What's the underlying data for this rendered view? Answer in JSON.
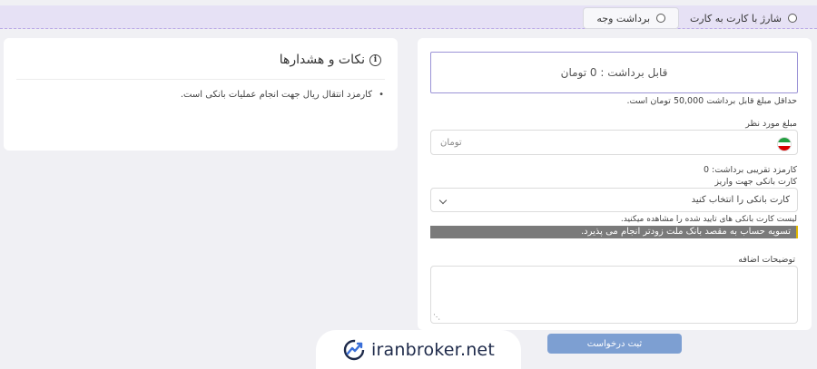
{
  "tabs": [
    {
      "label": "شارژ با کارت به کارت",
      "active": false
    },
    {
      "label": "برداشت وجه",
      "active": true
    }
  ],
  "notes": {
    "title": "نکات و هشدارها",
    "icon": "info-icon",
    "items": [
      "کارمزد انتقال ریال جهت انجام عملیات بانکی است."
    ]
  },
  "form": {
    "balance_text": "قابل برداشت : 0 تومان",
    "min_text": "حداقل مبلغ قابل برداشت 50,000 تومان است.",
    "amount_label": "مبلغ مورد نظر",
    "amount_placeholder": "تومان",
    "fee_text": "کارمزد تقریبی برداشت: 0",
    "card_label": "کارت بانکی جهت واریز",
    "card_select_value": "کارت بانکی را انتخاب کنید",
    "card_hint": "لیست کارت بانکی های تایید شده را مشاهده میکنید.",
    "settlement_notice": "تسویه حساب به مقصد بانک ملت زودتر انجام می پذیرد.",
    "description_label": "توضیحات اضافه",
    "submit_label": "ثبت درخواست"
  },
  "brand": {
    "logo_text": "iranbroker.net",
    "color": "#1e2a4a",
    "accent": "#3a6fd8"
  },
  "colors": {
    "tab_bar": "#e6e1f5",
    "button": "#7d9fd2",
    "notice": "#7a7a7a"
  }
}
